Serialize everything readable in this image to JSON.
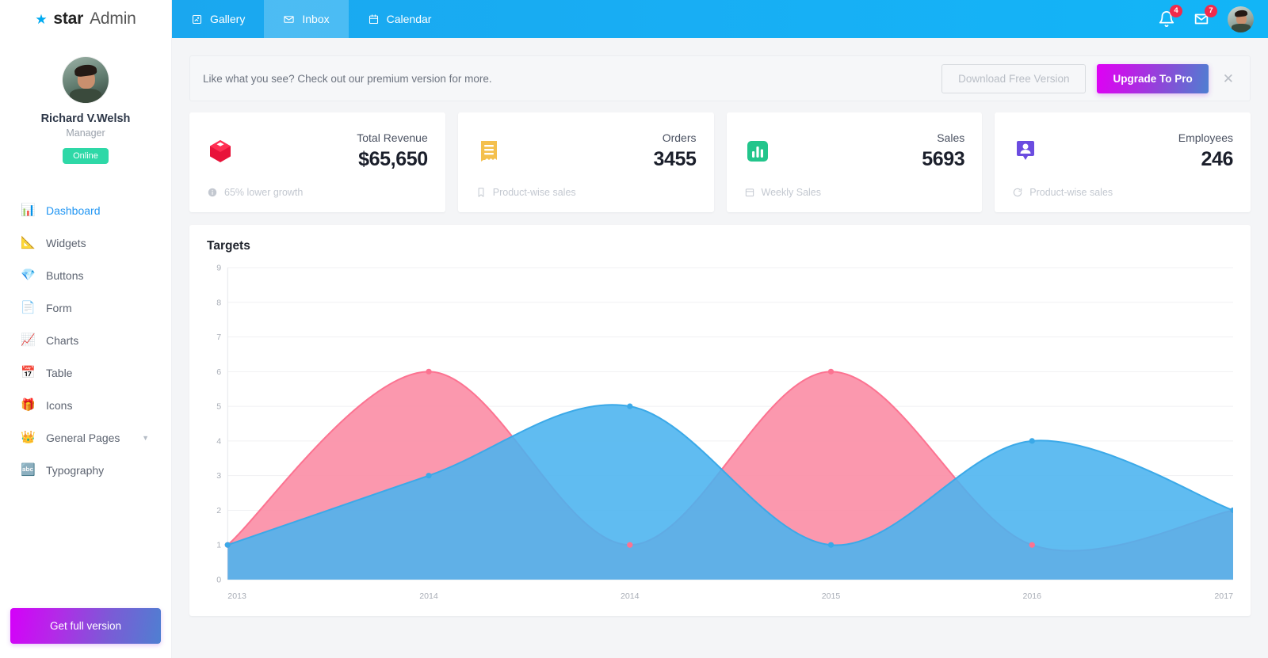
{
  "brand": {
    "star_icon": "star-icon",
    "name_bold": "star",
    "name_light": "Admin"
  },
  "sidebar": {
    "profile": {
      "name": "Richard V.Welsh",
      "role": "Manager",
      "status": "Online"
    },
    "items": [
      {
        "label": "Dashboard",
        "icon": "dashboard-icon",
        "glyph": "📊",
        "active": true,
        "caret": false
      },
      {
        "label": "Widgets",
        "icon": "widgets-icon",
        "glyph": "📐",
        "active": false,
        "caret": false
      },
      {
        "label": "Buttons",
        "icon": "buttons-icon",
        "glyph": "💎",
        "active": false,
        "caret": false
      },
      {
        "label": "Form",
        "icon": "form-icon",
        "glyph": "📄",
        "active": false,
        "caret": false
      },
      {
        "label": "Charts",
        "icon": "charts-icon",
        "glyph": "📈",
        "active": false,
        "caret": false
      },
      {
        "label": "Table",
        "icon": "table-icon",
        "glyph": "📅",
        "active": false,
        "caret": false
      },
      {
        "label": "Icons",
        "icon": "gift-icon",
        "glyph": "🎁",
        "active": false,
        "caret": false
      },
      {
        "label": "General Pages",
        "icon": "crown-icon",
        "glyph": "👑",
        "active": false,
        "caret": true
      },
      {
        "label": "Typography",
        "icon": "typography-icon",
        "glyph": "🔤",
        "active": false,
        "caret": false
      }
    ],
    "full_version_button": "Get full version"
  },
  "topbar": {
    "tabs": [
      {
        "label": "Gallery",
        "icon": "gallery-icon",
        "active": false
      },
      {
        "label": "Inbox",
        "icon": "envelope-icon",
        "active": true
      },
      {
        "label": "Calendar",
        "icon": "calendar-icon",
        "active": false
      }
    ],
    "notifications_badge": "4",
    "messages_badge": "7"
  },
  "banner": {
    "text": "Like what you see? Check out our premium version for more.",
    "free_button": "Download Free Version",
    "pro_button": "Upgrade To Pro",
    "close_icon": "close-icon"
  },
  "cards": [
    {
      "label": "Total Revenue",
      "value": "$65,650",
      "footer": "65% lower growth",
      "icon": "red-box-icon",
      "foot_icon": "info-icon",
      "color": "#e8133a"
    },
    {
      "label": "Orders",
      "value": "3455",
      "footer": "Product-wise sales",
      "icon": "receipt-icon",
      "foot_icon": "bookmark-icon",
      "color": "#f4c04e"
    },
    {
      "label": "Sales",
      "value": "5693",
      "footer": "Weekly Sales",
      "icon": "bar-chart-icon",
      "foot_icon": "calendar-icon",
      "color": "#22c58b"
    },
    {
      "label": "Employees",
      "value": "246",
      "footer": "Product-wise sales",
      "icon": "person-pin-icon",
      "foot_icon": "refresh-icon",
      "color": "#6b4ce0"
    }
  ],
  "panel": {
    "title": "Targets"
  },
  "chart_data": {
    "type": "area",
    "title": "Targets",
    "xlabel": "",
    "ylabel": "",
    "x": [
      "2013",
      "2014",
      "2014",
      "2015",
      "2016",
      "2017"
    ],
    "categories": [
      "2013",
      "2014",
      "2014",
      "2015",
      "2016",
      "2017"
    ],
    "yticks": [
      0,
      1,
      2,
      3,
      4,
      5,
      6,
      7,
      8,
      9
    ],
    "ylim": [
      0,
      9
    ],
    "grid": true,
    "legend": "none",
    "smooth": true,
    "series": [
      {
        "name": "Pink series",
        "color": "#fc7391",
        "fill": "#fb8aa3",
        "values": [
          1,
          6,
          1,
          6,
          1,
          2
        ]
      },
      {
        "name": "Blue series",
        "color": "#3ba9e8",
        "fill": "#4ab3ef",
        "values": [
          1,
          3,
          5,
          1,
          4,
          2
        ]
      }
    ]
  }
}
